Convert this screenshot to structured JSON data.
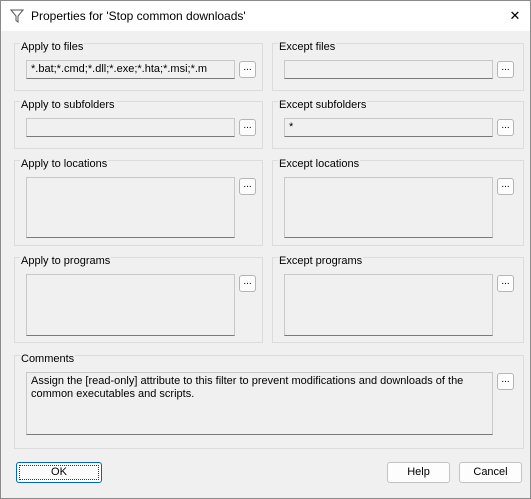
{
  "window": {
    "title": "Properties for 'Stop common downloads'",
    "title_icon": "filter-icon",
    "close_icon": "close-icon",
    "close_glyph": "✕"
  },
  "groups": {
    "apply_files": {
      "label": "Apply to files",
      "value": "*.bat;*.cmd;*.dll;*.exe;*.hta;*.msi;*.m"
    },
    "except_files": {
      "label": "Except files",
      "value": ""
    },
    "apply_subfolders": {
      "label": "Apply to subfolders",
      "value": ""
    },
    "except_subfolders": {
      "label": "Except subfolders",
      "value": "*"
    },
    "apply_locations": {
      "label": "Apply to locations",
      "value": ""
    },
    "except_locations": {
      "label": "Except locations",
      "value": ""
    },
    "apply_programs": {
      "label": "Apply to programs",
      "value": ""
    },
    "except_programs": {
      "label": "Except programs",
      "value": ""
    },
    "comments": {
      "label": "Comments",
      "value": "Assign the [read-only] attribute to this filter to prevent modifications and downloads of the common executables and scripts."
    }
  },
  "browse_label": "...",
  "buttons": {
    "ok": "OK",
    "help": "Help",
    "cancel": "Cancel"
  }
}
